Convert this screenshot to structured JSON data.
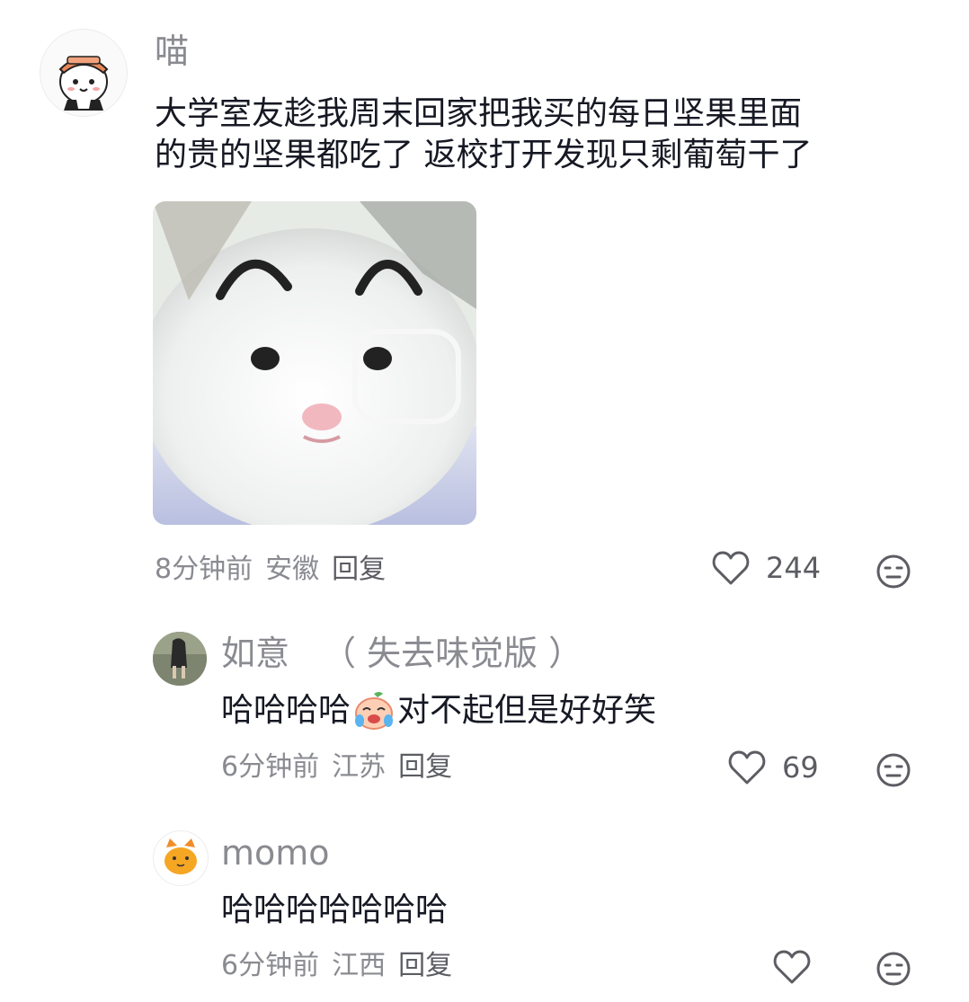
{
  "comments": [
    {
      "username": "喵",
      "text_line1": "大学室友趁我周末回家把我买的每日坚果里面",
      "text_line2": "的贵的坚果都吃了 返校打开发现只剩葡萄干了",
      "time": "8分钟前",
      "location": "安徽",
      "reply_label": "回复",
      "likes": "244"
    },
    {
      "username": "如意",
      "username_suffix": "（ 失去味觉版 ）",
      "text_before_emoji": "哈哈哈哈",
      "emoji": "crying-laughing-peach-emoji",
      "text_after_emoji": "对不起但是好好笑",
      "time": "6分钟前",
      "location": "江苏",
      "reply_label": "回复",
      "likes": "69"
    },
    {
      "username": "momo",
      "text": "哈哈哈哈哈哈哈",
      "time": "6分钟前",
      "location": "江西",
      "reply_label": "回复",
      "likes": ""
    }
  ],
  "colors": {
    "secondary_text": "#8a8b91",
    "primary_text": "#161823",
    "icon": "#5c5d63"
  },
  "icons": [
    "heart-outline-icon",
    "dislike-face-icon"
  ]
}
